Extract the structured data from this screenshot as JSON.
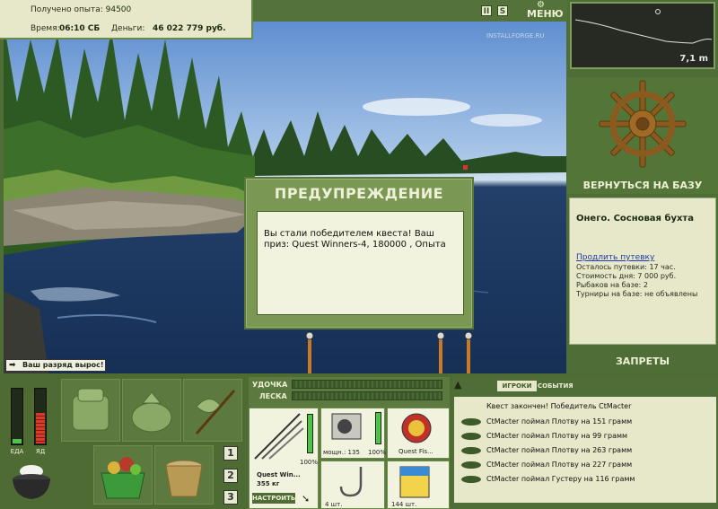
{
  "info": {
    "exp_label": "Получено опыта:",
    "exp_value": "94500",
    "time_label": "Время:",
    "time_value": "06:10 СБ",
    "money_label": "Деньги:",
    "money_value": "46 022 779 руб."
  },
  "top_buttons": {
    "pause": "II",
    "sound": "S",
    "menu": "МЕНЮ"
  },
  "watermark": "INSTALLFORGE.RU",
  "depth": {
    "value": "7,1 m"
  },
  "right_panel": {
    "return_label": "ВЕРНУТЬСЯ НА БАЗУ",
    "base_name": "Онего. Сосновая бухта",
    "extend_link": "Продлить путевку",
    "lines": [
      "Осталось путевки: 17 час.",
      "Стоимость дня: 7 000 руб.",
      "Рыбаков на базе: 2",
      "Турниры на базе: не объявлены"
    ],
    "bans_label": "ЗАПРЕТЫ"
  },
  "dialog": {
    "title": "ПРЕДУПРЕЖДЕНИЕ",
    "message": "Вы стали победителем квеста! Ваш приз: Quest Winners-4, 180000 , Опыта"
  },
  "rank_notice": "Ваш разряд вырос!",
  "stats": {
    "food_label": "ЕДА",
    "poison_label": "ЯД",
    "food_level": 0.08,
    "poison_level": 0.55
  },
  "pages": [
    "1",
    "2",
    "3"
  ],
  "tackle": {
    "rod_label": "УДОЧКА",
    "line_label": "ЛЕСКА",
    "rod_name": "Quest Win...",
    "rod_weight": "355 кг",
    "rod_percent": "100%",
    "reel_caption": "мощн.: 135",
    "reel_percent": "100%",
    "line_name": "Quest Fis...",
    "hook_count": "4 шт.",
    "bait_count": "144 шт.",
    "setup_button": "НАСТРОИТЬ"
  },
  "feed": {
    "tab_players": "ИГРОКИ",
    "tab_events": "СОБЫТИЯ",
    "header": "Квест закончен! Победитель CtMacter",
    "rows": [
      "CtMacter поймал Плотву на 151 грамм",
      "CtMacter поймал Плотву на 99 грамм",
      "CtMacter поймал Плотву на 263 грамм",
      "CtMacter поймал Плотву на 227 грамм",
      "CtMacter поймал Густеру на 116 грамм"
    ]
  },
  "colors": {
    "panel_green": "#4f6d36",
    "panel_cream": "#e6e8c9",
    "accent_link": "#1e3aa8"
  }
}
